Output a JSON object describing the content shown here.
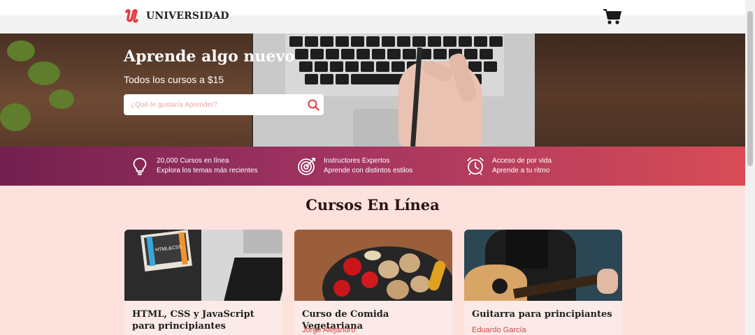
{
  "header": {
    "brand": "UNIVERSIDAD"
  },
  "hero": {
    "title": "Aprende algo nuevo",
    "subtitle": "Todos los cursos a $15",
    "search_placeholder": "¿Qué te gustaría Aprender?"
  },
  "features": [
    {
      "icon": "lightbulb-icon",
      "line1": "20,000 Cursos en línea",
      "line2": "Explora los temas más recientes"
    },
    {
      "icon": "target-icon",
      "line1": "Instructores Expertos",
      "line2": "Aprende con distintos estilos"
    },
    {
      "icon": "alarm-clock-icon",
      "line1": "Acceso de por vida",
      "line2": "Aprende a tu ritmo"
    }
  ],
  "courses": {
    "title": "Cursos En Línea",
    "items": [
      {
        "title": "HTML, CSS y JavaScript para principiantes",
        "author": "",
        "image": "laptop-book-image"
      },
      {
        "title": "Curso de Comida Vegetariana",
        "author": "Jorge Alejandro",
        "image": "vegetables-pan-image"
      },
      {
        "title": "Guitarra para principiantes",
        "author": "Eduardo García",
        "image": "guitar-image"
      }
    ]
  },
  "colors": {
    "accent": "#e03c3c",
    "band_start": "#73204f",
    "band_end": "#d84c56",
    "background": "#fde1dd"
  }
}
